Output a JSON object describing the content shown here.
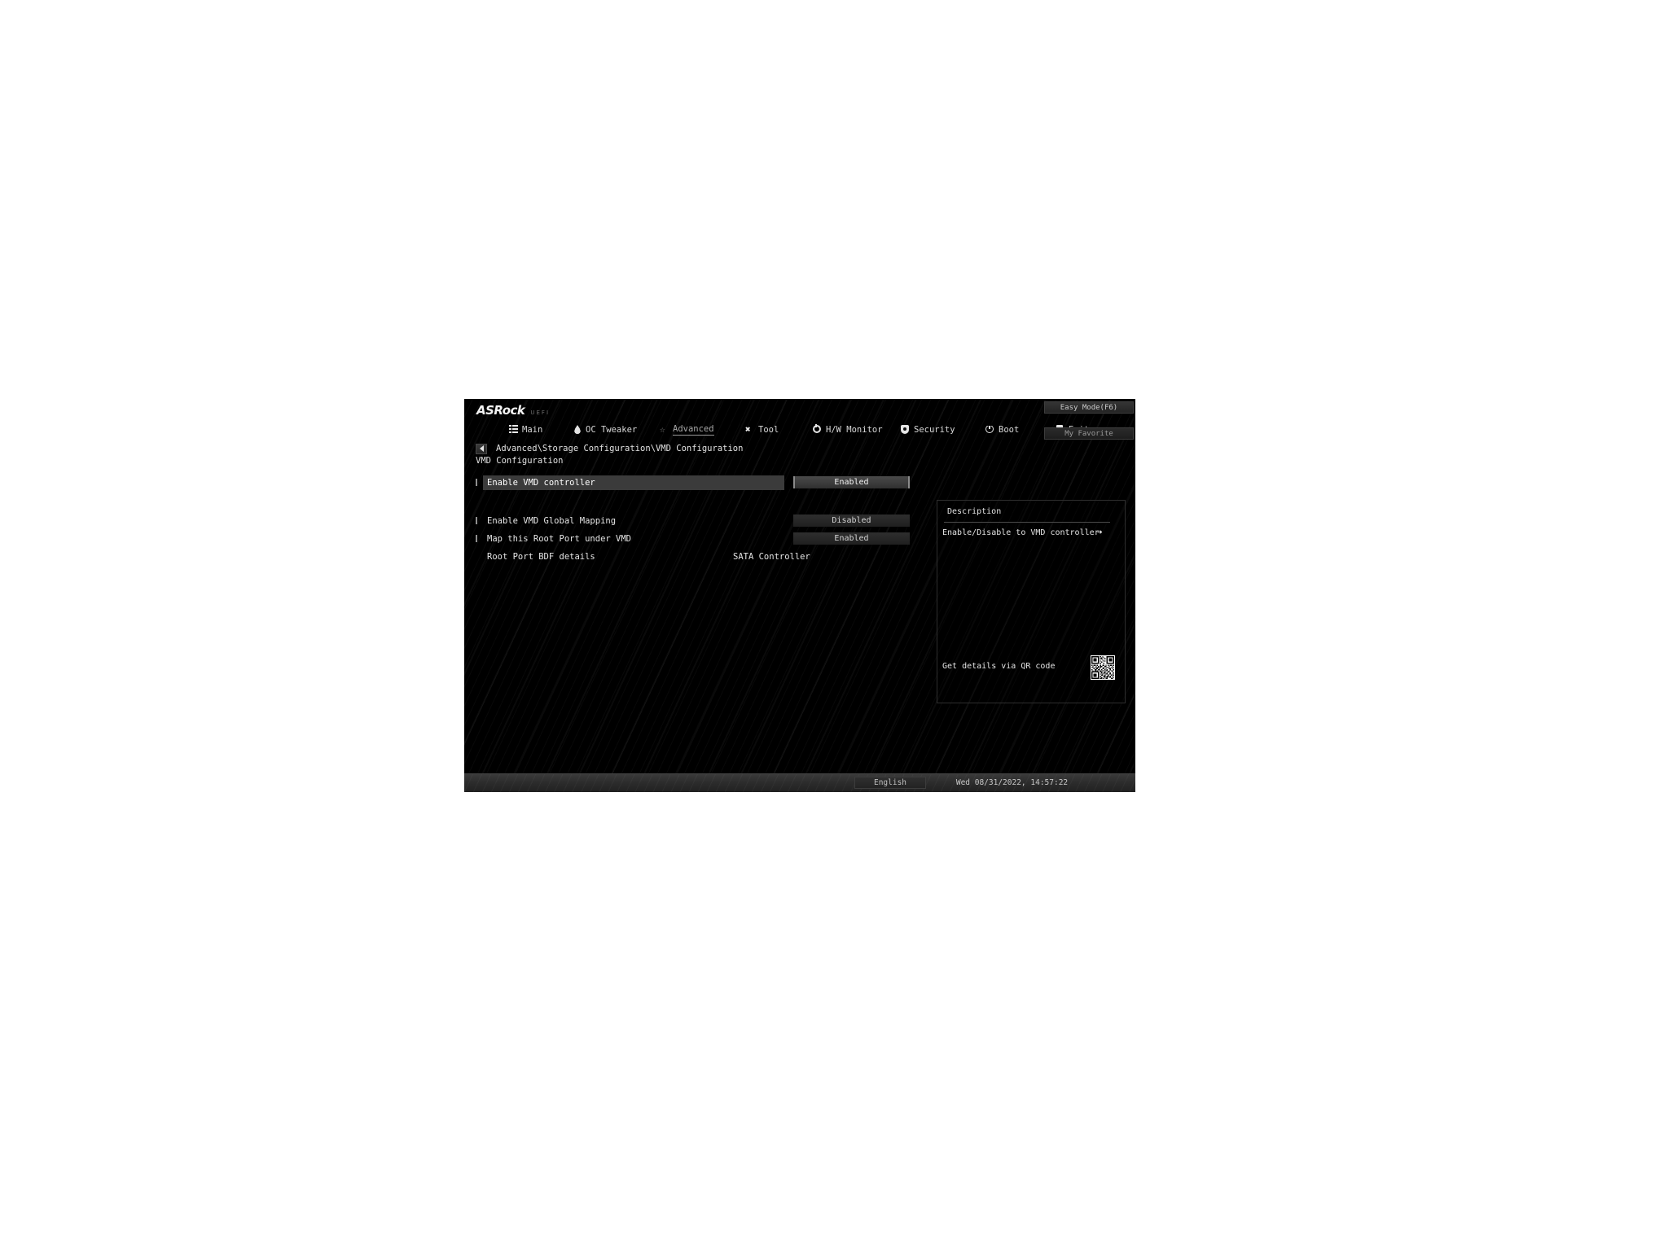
{
  "brand": {
    "logo": "ASRock",
    "logo_sub": "UEFI"
  },
  "nav": {
    "items": [
      {
        "label": "Main",
        "icon": "grid-icon",
        "active": false
      },
      {
        "label": "OC Tweaker",
        "icon": "flame-icon",
        "active": false
      },
      {
        "label": "Advanced",
        "icon": "star-icon",
        "active": true
      },
      {
        "label": "Tool",
        "icon": "tools-icon",
        "active": false
      },
      {
        "label": "H/W Monitor",
        "icon": "gauge-icon",
        "active": false
      },
      {
        "label": "Security",
        "icon": "shield-icon",
        "active": false
      },
      {
        "label": "Boot",
        "icon": "power-icon",
        "active": false
      },
      {
        "label": "Exit",
        "icon": "exit-icon",
        "active": false
      }
    ]
  },
  "corner_buttons": {
    "easy_mode": "Easy Mode(F6)",
    "my_favorite": "My Favorite"
  },
  "breadcrumb": "Advanced\\Storage Configuration\\VMD Configuration",
  "page_title": "VMD Configuration",
  "settings": [
    {
      "label": "Enable VMD controller",
      "value": "Enabled",
      "type": "dropdown",
      "selected": true,
      "bulleted": true
    },
    {
      "label": "Enable VMD Global Mapping",
      "value": "Disabled",
      "type": "dropdown",
      "selected": false,
      "bulleted": true
    },
    {
      "label": "Map this Root Port under VMD",
      "value": "Enabled",
      "type": "dropdown",
      "selected": false,
      "bulleted": true
    },
    {
      "label": "Root Port BDF details",
      "value": "SATA Controller",
      "type": "text",
      "selected": false,
      "bulleted": false
    }
  ],
  "description": {
    "title": "Description",
    "body": "Enable/Disable to VMD controller",
    "qr_label": "Get details via QR code"
  },
  "footer": {
    "language": "English",
    "datetime": "Wed 08/31/2022, 14:57:22"
  },
  "colors": {
    "window_bg": "#000000",
    "text": "#e5e5e5",
    "accent_highlight": "#3b3b3b",
    "button_border": "#8a8a8a"
  }
}
